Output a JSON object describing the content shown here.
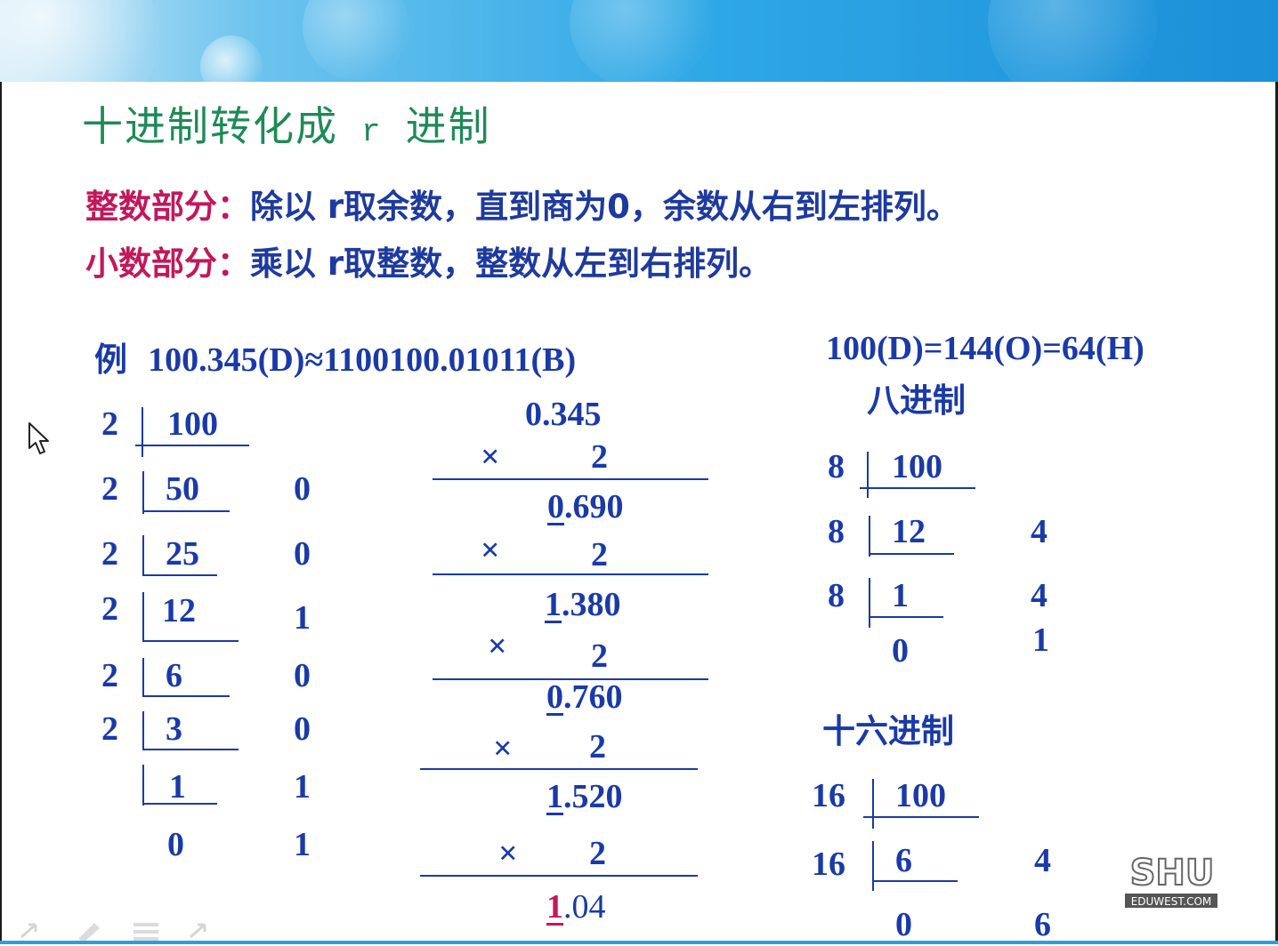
{
  "title": {
    "prefix": "十进制转化成",
    "r": "r",
    "suffix": "进制"
  },
  "rules": [
    {
      "label": "整数部分：",
      "text": "除以 r取余数，直到商为0，余数从右到左排列。"
    },
    {
      "label": "小数部分：",
      "text": "乘以 r取整数，整数从左到右排列。"
    }
  ],
  "example": {
    "prefix": "例",
    "expr_left": "100.345(D)",
    "approx": "≈",
    "expr_right": "1100100.01011(B)"
  },
  "binary_int": {
    "divisors": [
      "2",
      "2",
      "2",
      "2",
      "2",
      "2"
    ],
    "quotients": [
      "100",
      "50",
      "25",
      "12",
      "6",
      "3",
      "1",
      "0"
    ],
    "remainders": [
      "0",
      "0",
      "1",
      "0",
      "0",
      "1",
      "1"
    ]
  },
  "binary_frac": {
    "start": "0.345",
    "multiply_sign": "×",
    "multiplier": "2",
    "results": [
      {
        "int": "0",
        "frac": ".690"
      },
      {
        "int": "1",
        "frac": ".380"
      },
      {
        "int": "0",
        "frac": ".760"
      },
      {
        "int": "1",
        "frac": ".520"
      },
      {
        "int": "1",
        "frac": ".04"
      }
    ]
  },
  "conversion": {
    "line": "100(D)=144(O)=64(H)"
  },
  "octal": {
    "heading": "八进制",
    "divisors": [
      "8",
      "8",
      "8"
    ],
    "quotients": [
      "100",
      "12",
      "1",
      "0"
    ],
    "remainders": [
      "4",
      "4",
      "1"
    ]
  },
  "hex": {
    "heading": "十六进制",
    "divisors": [
      "16",
      "16"
    ],
    "quotients": [
      "100",
      "6",
      "0"
    ],
    "remainders": [
      "4",
      "6"
    ]
  },
  "logo": {
    "mark": "SHU",
    "site": "EDUWEST.COM"
  },
  "colors": {
    "title": "#1f8a57",
    "label": "#c2185b",
    "body": "#1a3aa8",
    "banner": "#2fa8e6"
  },
  "icons": [
    "cursor-arrow-icon",
    "pen-icon",
    "menu-icon",
    "arrow-icon"
  ]
}
